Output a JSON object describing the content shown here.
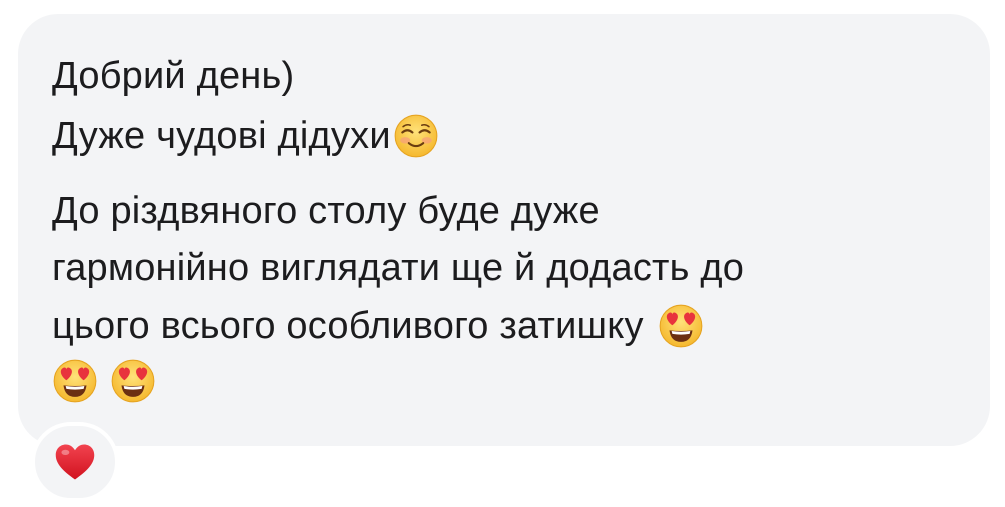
{
  "message": {
    "line1": "Добрий день)",
    "line2": "Дуже чудові дідухи",
    "line3": "До різдвяного столу буде дуже",
    "line4": "гармонійно виглядати ще й додасть до",
    "line5": "цього всього особливого затишку",
    "emojis": {
      "line2_end": "smiling-face-with-blush",
      "line5_end": "smiling-face-with-heart-eyes",
      "line6": [
        "smiling-face-with-heart-eyes",
        "smiling-face-with-heart-eyes"
      ]
    }
  },
  "reaction": {
    "icon": "red-heart-icon",
    "color": "#e0202f"
  },
  "colors": {
    "bubble": "#f3f4f6",
    "text": "#1c1c1e"
  }
}
